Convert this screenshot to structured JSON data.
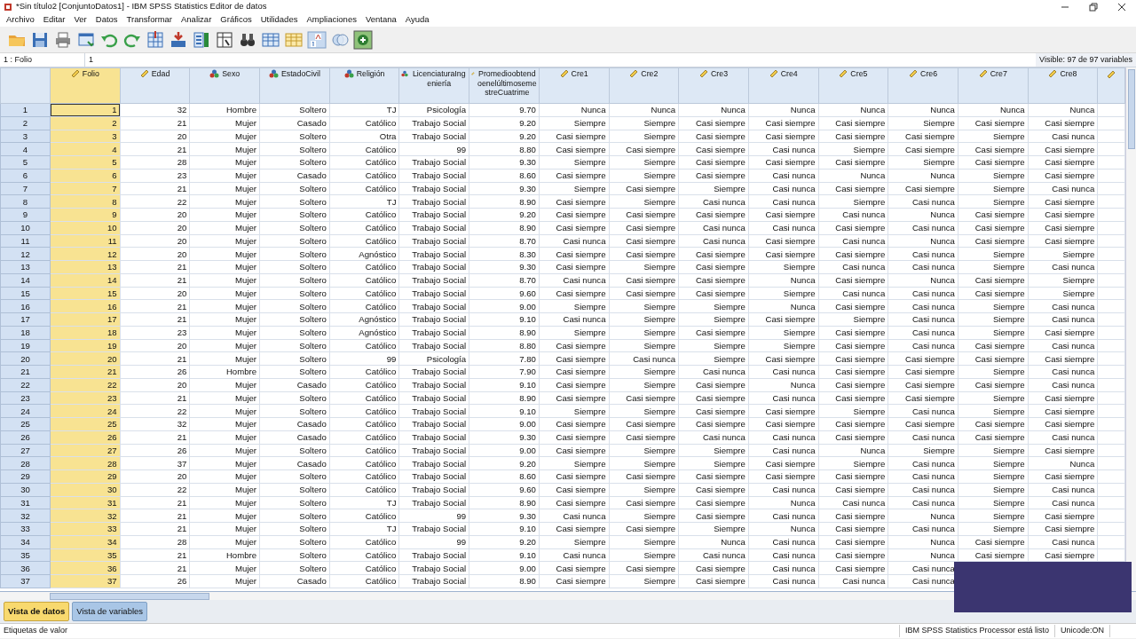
{
  "window": {
    "title": "*Sin título2 [ConjuntoDatos1] - IBM SPSS Statistics Editor de datos"
  },
  "menu": [
    "Archivo",
    "Editar",
    "Ver",
    "Datos",
    "Transformar",
    "Analizar",
    "Gráficos",
    "Utilidades",
    "Ampliaciones",
    "Ventana",
    "Ayuda"
  ],
  "cell_editor": {
    "reference": "1 : Folio",
    "value": "1",
    "visible": "Visible: 97 de 97 variables"
  },
  "columns": [
    {
      "name": "Folio",
      "kind": "scale",
      "highlighted": true
    },
    {
      "name": "Edad",
      "kind": "scale",
      "highlighted": false
    },
    {
      "name": "Sexo",
      "kind": "nominal",
      "highlighted": false
    },
    {
      "name": "EstadoCivil",
      "kind": "nominal",
      "highlighted": false
    },
    {
      "name": "Religión",
      "kind": "nominal",
      "highlighted": false
    },
    {
      "name": "LicenciaturaIngeniería",
      "kind": "nominal",
      "highlighted": false
    },
    {
      "name": "PromedioobtendoenelúltimosemestreCuatrime",
      "kind": "scale",
      "highlighted": false
    },
    {
      "name": "Cre1",
      "kind": "scale",
      "highlighted": false
    },
    {
      "name": "Cre2",
      "kind": "scale",
      "highlighted": false
    },
    {
      "name": "Cre3",
      "kind": "scale",
      "highlighted": false
    },
    {
      "name": "Cre4",
      "kind": "scale",
      "highlighted": false
    },
    {
      "name": "Cre5",
      "kind": "scale",
      "highlighted": false
    },
    {
      "name": "Cre6",
      "kind": "scale",
      "highlighted": false
    },
    {
      "name": "Cre7",
      "kind": "scale",
      "highlighted": false
    },
    {
      "name": "Cre8",
      "kind": "scale",
      "highlighted": false
    }
  ],
  "rows": [
    {
      "label": "1",
      "focused": true,
      "cells": [
        "1",
        "32",
        "Hombre",
        "Soltero",
        "TJ",
        "Psicología",
        "9.70",
        "Nunca",
        "Nunca",
        "Nunca",
        "Nunca",
        "Nunca",
        "Nunca",
        "Nunca",
        "Nunca"
      ]
    },
    {
      "label": "2",
      "focused": false,
      "cells": [
        "2",
        "21",
        "Mujer",
        "Casado",
        "Católico",
        "Trabajo Social",
        "9.20",
        "Siempre",
        "Siempre",
        "Casi siempre",
        "Casi siempre",
        "Casi siempre",
        "Siempre",
        "Casi siempre",
        "Casi siempre"
      ]
    },
    {
      "label": "3",
      "focused": false,
      "cells": [
        "3",
        "20",
        "Mujer",
        "Soltero",
        "Otra",
        "Trabajo Social",
        "9.20",
        "Casi siempre",
        "Siempre",
        "Casi siempre",
        "Casi siempre",
        "Casi siempre",
        "Casi siempre",
        "Siempre",
        "Casi nunca"
      ]
    },
    {
      "label": "4",
      "focused": false,
      "cells": [
        "4",
        "21",
        "Mujer",
        "Soltero",
        "Católico",
        "99",
        "8.80",
        "Casi siempre",
        "Casi siempre",
        "Casi siempre",
        "Casi nunca",
        "Siempre",
        "Casi siempre",
        "Casi siempre",
        "Casi siempre"
      ]
    },
    {
      "label": "5",
      "focused": false,
      "cells": [
        "5",
        "28",
        "Mujer",
        "Soltero",
        "Católico",
        "Trabajo Social",
        "9.30",
        "Siempre",
        "Siempre",
        "Casi siempre",
        "Casi siempre",
        "Casi siempre",
        "Siempre",
        "Casi siempre",
        "Casi siempre"
      ]
    },
    {
      "label": "6",
      "focused": false,
      "cells": [
        "6",
        "23",
        "Mujer",
        "Casado",
        "Católico",
        "Trabajo Social",
        "8.60",
        "Casi siempre",
        "Siempre",
        "Casi siempre",
        "Casi nunca",
        "Nunca",
        "Nunca",
        "Siempre",
        "Casi siempre"
      ]
    },
    {
      "label": "7",
      "focused": false,
      "cells": [
        "7",
        "21",
        "Mujer",
        "Soltero",
        "Católico",
        "Trabajo Social",
        "9.30",
        "Siempre",
        "Casi siempre",
        "Siempre",
        "Casi nunca",
        "Casi siempre",
        "Casi siempre",
        "Siempre",
        "Casi nunca"
      ]
    },
    {
      "label": "8",
      "focused": false,
      "cells": [
        "8",
        "22",
        "Mujer",
        "Soltero",
        "TJ",
        "Trabajo Social",
        "8.90",
        "Casi siempre",
        "Siempre",
        "Casi nunca",
        "Casi nunca",
        "Siempre",
        "Casi nunca",
        "Siempre",
        "Casi siempre"
      ]
    },
    {
      "label": "9",
      "focused": false,
      "cells": [
        "9",
        "20",
        "Mujer",
        "Soltero",
        "Católico",
        "Trabajo Social",
        "9.20",
        "Casi siempre",
        "Casi siempre",
        "Casi siempre",
        "Casi siempre",
        "Casi nunca",
        "Nunca",
        "Casi siempre",
        "Casi siempre"
      ]
    },
    {
      "label": "10",
      "focused": false,
      "cells": [
        "10",
        "20",
        "Mujer",
        "Soltero",
        "Católico",
        "Trabajo Social",
        "8.90",
        "Casi siempre",
        "Casi siempre",
        "Casi nunca",
        "Casi nunca",
        "Casi siempre",
        "Casi nunca",
        "Casi siempre",
        "Casi siempre"
      ]
    },
    {
      "label": "11",
      "focused": false,
      "cells": [
        "11",
        "20",
        "Mujer",
        "Soltero",
        "Católico",
        "Trabajo Social",
        "8.70",
        "Casi nunca",
        "Casi siempre",
        "Casi nunca",
        "Casi siempre",
        "Casi nunca",
        "Nunca",
        "Casi siempre",
        "Casi siempre"
      ]
    },
    {
      "label": "12",
      "focused": false,
      "cells": [
        "12",
        "20",
        "Mujer",
        "Soltero",
        "Agnóstico",
        "Trabajo Social",
        "8.30",
        "Casi siempre",
        "Casi siempre",
        "Casi siempre",
        "Casi siempre",
        "Casi siempre",
        "Casi nunca",
        "Siempre",
        "Siempre"
      ]
    },
    {
      "label": "13",
      "focused": false,
      "cells": [
        "13",
        "21",
        "Mujer",
        "Soltero",
        "Católico",
        "Trabajo Social",
        "9.30",
        "Casi siempre",
        "Siempre",
        "Casi siempre",
        "Siempre",
        "Casi nunca",
        "Casi nunca",
        "Siempre",
        "Casi nunca"
      ]
    },
    {
      "label": "14",
      "focused": false,
      "cells": [
        "14",
        "21",
        "Mujer",
        "Soltero",
        "Católico",
        "Trabajo Social",
        "8.70",
        "Casi nunca",
        "Casi siempre",
        "Casi siempre",
        "Nunca",
        "Casi siempre",
        "Nunca",
        "Casi siempre",
        "Siempre"
      ]
    },
    {
      "label": "15",
      "focused": false,
      "cells": [
        "15",
        "20",
        "Mujer",
        "Soltero",
        "Católico",
        "Trabajo Social",
        "9.60",
        "Casi siempre",
        "Casi siempre",
        "Casi siempre",
        "Siempre",
        "Casi nunca",
        "Casi nunca",
        "Casi siempre",
        "Siempre"
      ]
    },
    {
      "label": "16",
      "focused": false,
      "cells": [
        "16",
        "21",
        "Mujer",
        "Soltero",
        "Católico",
        "Trabajo Social",
        "9.00",
        "Siempre",
        "Siempre",
        "Siempre",
        "Nunca",
        "Casi siempre",
        "Casi nunca",
        "Siempre",
        "Casi nunca"
      ]
    },
    {
      "label": "17",
      "focused": false,
      "cells": [
        "17",
        "21",
        "Mujer",
        "Soltero",
        "Agnóstico",
        "Trabajo Social",
        "9.10",
        "Casi nunca",
        "Siempre",
        "Siempre",
        "Casi siempre",
        "Siempre",
        "Casi nunca",
        "Siempre",
        "Casi nunca"
      ]
    },
    {
      "label": "18",
      "focused": false,
      "cells": [
        "18",
        "23",
        "Mujer",
        "Soltero",
        "Agnóstico",
        "Trabajo Social",
        "8.90",
        "Siempre",
        "Siempre",
        "Casi siempre",
        "Siempre",
        "Casi siempre",
        "Casi nunca",
        "Siempre",
        "Casi siempre"
      ]
    },
    {
      "label": "19",
      "focused": false,
      "cells": [
        "19",
        "20",
        "Mujer",
        "Soltero",
        "Católico",
        "Trabajo Social",
        "8.80",
        "Casi siempre",
        "Siempre",
        "Siempre",
        "Siempre",
        "Casi siempre",
        "Casi nunca",
        "Casi siempre",
        "Casi nunca"
      ]
    },
    {
      "label": "20",
      "focused": false,
      "cells": [
        "20",
        "21",
        "Mujer",
        "Soltero",
        "99",
        "Psicología",
        "7.80",
        "Casi siempre",
        "Casi nunca",
        "Siempre",
        "Casi siempre",
        "Casi siempre",
        "Casi siempre",
        "Casi siempre",
        "Casi siempre"
      ]
    },
    {
      "label": "21",
      "focused": false,
      "cells": [
        "21",
        "26",
        "Hombre",
        "Soltero",
        "Católico",
        "Trabajo Social",
        "7.90",
        "Casi siempre",
        "Siempre",
        "Casi nunca",
        "Casi nunca",
        "Casi siempre",
        "Casi siempre",
        "Siempre",
        "Casi nunca"
      ]
    },
    {
      "label": "22",
      "focused": false,
      "cells": [
        "22",
        "20",
        "Mujer",
        "Casado",
        "Católico",
        "Trabajo Social",
        "9.10",
        "Casi siempre",
        "Siempre",
        "Casi siempre",
        "Nunca",
        "Casi siempre",
        "Casi siempre",
        "Casi siempre",
        "Casi nunca"
      ]
    },
    {
      "label": "23",
      "focused": false,
      "cells": [
        "23",
        "21",
        "Mujer",
        "Soltero",
        "Católico",
        "Trabajo Social",
        "8.90",
        "Casi siempre",
        "Casi siempre",
        "Casi siempre",
        "Casi nunca",
        "Casi siempre",
        "Casi siempre",
        "Siempre",
        "Casi siempre"
      ]
    },
    {
      "label": "24",
      "focused": false,
      "cells": [
        "24",
        "22",
        "Mujer",
        "Soltero",
        "Católico",
        "Trabajo Social",
        "9.10",
        "Siempre",
        "Siempre",
        "Casi siempre",
        "Casi siempre",
        "Siempre",
        "Casi nunca",
        "Siempre",
        "Casi siempre"
      ]
    },
    {
      "label": "25",
      "focused": false,
      "cells": [
        "25",
        "32",
        "Mujer",
        "Casado",
        "Católico",
        "Trabajo Social",
        "9.00",
        "Casi siempre",
        "Casi siempre",
        "Casi siempre",
        "Casi siempre",
        "Casi siempre",
        "Casi siempre",
        "Casi siempre",
        "Casi siempre"
      ]
    },
    {
      "label": "26",
      "focused": false,
      "cells": [
        "26",
        "21",
        "Mujer",
        "Casado",
        "Católico",
        "Trabajo Social",
        "9.30",
        "Casi siempre",
        "Casi siempre",
        "Casi nunca",
        "Casi nunca",
        "Casi siempre",
        "Casi nunca",
        "Casi siempre",
        "Casi nunca"
      ]
    },
    {
      "label": "27",
      "focused": false,
      "cells": [
        "27",
        "26",
        "Mujer",
        "Soltero",
        "Católico",
        "Trabajo Social",
        "9.00",
        "Casi siempre",
        "Siempre",
        "Siempre",
        "Casi nunca",
        "Nunca",
        "Siempre",
        "Siempre",
        "Casi siempre"
      ]
    },
    {
      "label": "28",
      "focused": false,
      "cells": [
        "28",
        "37",
        "Mujer",
        "Casado",
        "Católico",
        "Trabajo Social",
        "9.20",
        "Siempre",
        "Siempre",
        "Siempre",
        "Casi siempre",
        "Siempre",
        "Casi nunca",
        "Siempre",
        "Nunca"
      ]
    },
    {
      "label": "29",
      "focused": false,
      "cells": [
        "29",
        "20",
        "Mujer",
        "Soltero",
        "Católico",
        "Trabajo Social",
        "8.60",
        "Casi siempre",
        "Casi siempre",
        "Casi siempre",
        "Casi siempre",
        "Casi siempre",
        "Casi nunca",
        "Siempre",
        "Casi siempre"
      ]
    },
    {
      "label": "30",
      "focused": false,
      "cells": [
        "30",
        "22",
        "Mujer",
        "Soltero",
        "Católico",
        "Trabajo Social",
        "9.60",
        "Casi siempre",
        "Siempre",
        "Casi siempre",
        "Casi nunca",
        "Casi siempre",
        "Casi nunca",
        "Siempre",
        "Casi nunca"
      ]
    },
    {
      "label": "31",
      "focused": false,
      "cells": [
        "31",
        "21",
        "Mujer",
        "Soltero",
        "TJ",
        "Trabajo Social",
        "8.90",
        "Casi siempre",
        "Casi siempre",
        "Casi siempre",
        "Nunca",
        "Casi nunca",
        "Casi nunca",
        "Siempre",
        "Casi nunca"
      ]
    },
    {
      "label": "32",
      "focused": false,
      "cells": [
        "32",
        "21",
        "Mujer",
        "Soltero",
        "Católico",
        "99",
        "9.30",
        "Casi nunca",
        "Siempre",
        "Casi siempre",
        "Casi nunca",
        "Casi siempre",
        "Nunca",
        "Siempre",
        "Casi siempre"
      ]
    },
    {
      "label": "33",
      "focused": false,
      "cells": [
        "33",
        "21",
        "Mujer",
        "Soltero",
        "TJ",
        "Trabajo Social",
        "9.10",
        "Casi siempre",
        "Casi siempre",
        "Siempre",
        "Nunca",
        "Casi siempre",
        "Casi nunca",
        "Siempre",
        "Casi siempre"
      ]
    },
    {
      "label": "34",
      "focused": false,
      "cells": [
        "34",
        "28",
        "Mujer",
        "Soltero",
        "Católico",
        "99",
        "9.20",
        "Siempre",
        "Siempre",
        "Nunca",
        "Casi nunca",
        "Casi siempre",
        "Nunca",
        "Casi siempre",
        "Casi nunca"
      ]
    },
    {
      "label": "35",
      "focused": false,
      "cells": [
        "35",
        "21",
        "Hombre",
        "Soltero",
        "Católico",
        "Trabajo Social",
        "9.10",
        "Casi nunca",
        "Siempre",
        "Casi nunca",
        "Casi nunca",
        "Casi siempre",
        "Nunca",
        "Casi siempre",
        "Casi siempre"
      ]
    },
    {
      "label": "36",
      "focused": false,
      "cells": [
        "36",
        "21",
        "Mujer",
        "Soltero",
        "Católico",
        "Trabajo Social",
        "9.00",
        "Casi siempre",
        "Casi siempre",
        "Casi siempre",
        "Casi nunca",
        "Casi siempre",
        "Casi nunca"
      ]
    },
    {
      "label": "37",
      "focused": false,
      "cells": [
        "37",
        "26",
        "Mujer",
        "Casado",
        "Católico",
        "Trabajo Social",
        "8.90",
        "Casi siempre",
        "Siempre",
        "Casi siempre",
        "Casi nunca",
        "Casi nunca",
        "Casi nunca"
      ]
    }
  ],
  "tabs": [
    {
      "label": "Vista de datos",
      "selected": true
    },
    {
      "label": "Vista de variables",
      "selected": false
    }
  ],
  "status_bar": [
    "Etiquetas de valor",
    "IBM SPSS Statistics Processor está listo",
    "Unicode:ON"
  ]
}
